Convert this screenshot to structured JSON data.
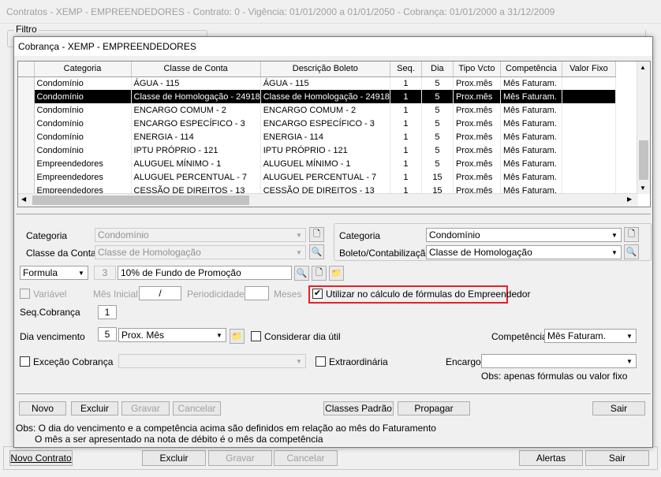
{
  "main_window": {
    "title": "Contratos - XEMP - EMPREENDEDORES - Contrato: 0 - Vigência: 01/01/2000 a 01/01/2050 - Cobrança: 01/01/2000 a 31/12/2009",
    "filter_label": "Filtro",
    "buttons": {
      "novo_contrato": "Novo Contrato",
      "excluir": "Excluir",
      "gravar": "Gravar",
      "cancelar": "Cancelar",
      "alertas": "Alertas",
      "sair": "Sair"
    }
  },
  "dialog": {
    "title": "Cobrança - XEMP - EMPREENDEDORES",
    "grid": {
      "columns": [
        "Categoria",
        "Classe de Conta",
        "Descrição Boleto",
        "Seq.",
        "Dia",
        "Tipo Vcto",
        "Competência",
        "Valor Fixo"
      ],
      "rows": [
        [
          "Condomínio",
          "ÁGUA - 115",
          "ÁGUA - 115",
          "1",
          "5",
          "Prox.mês",
          "Mês Faturam.",
          ""
        ],
        [
          "Condomínio",
          "Classe de Homologação - 24918",
          "Classe de Homologação - 24918",
          "1",
          "5",
          "Prox.mês",
          "Mês Faturam.",
          ""
        ],
        [
          "Condomínio",
          "ENCARGO COMUM - 2",
          "ENCARGO COMUM - 2",
          "1",
          "5",
          "Prox.mês",
          "Mês Faturam.",
          ""
        ],
        [
          "Condomínio",
          "ENCARGO ESPECÍFICO - 3",
          "ENCARGO ESPECÍFICO - 3",
          "1",
          "5",
          "Prox.mês",
          "Mês Faturam.",
          ""
        ],
        [
          "Condomínio",
          "ENERGIA - 114",
          "ENERGIA - 114",
          "1",
          "5",
          "Prox.mês",
          "Mês Faturam.",
          ""
        ],
        [
          "Condomínio",
          "IPTU PRÓPRIO - 121",
          "IPTU PRÓPRIO - 121",
          "1",
          "5",
          "Prox.mês",
          "Mês Faturam.",
          ""
        ],
        [
          "Empreendedores",
          "ALUGUEL MÍNIMO - 1",
          "ALUGUEL MÍNIMO - 1",
          "1",
          "5",
          "Prox.mês",
          "Mês Faturam.",
          ""
        ],
        [
          "Empreendedores",
          "ALUGUEL PERCENTUAL - 7",
          "ALUGUEL PERCENTUAL - 7",
          "1",
          "15",
          "Prox.mês",
          "Mês Faturam.",
          ""
        ],
        [
          "Empreendedores",
          "CESSÃO DE DIREITOS - 13",
          "CESSÃO DE DIREITOS - 13",
          "1",
          "15",
          "Prox.mês",
          "Mês Faturam.",
          ""
        ]
      ],
      "selected_row": 1
    },
    "form": {
      "categoria_label": "Categoria",
      "categoria_value": "Condomínio",
      "classe_conta_label": "Classe da Conta",
      "classe_conta_value": "Classe de Homologação",
      "categoria2_label": "Categoria",
      "categoria2_value": "Condomínio",
      "boleto_label": "Boleto/Contabilização",
      "boleto_value": "Classe de Homologação",
      "tipo_value": "Formula",
      "formula_num": "3",
      "formula_desc": "10% de Fundo de Promoção",
      "variavel_label": "Variável",
      "mes_inicial_label": "Mês Inicial",
      "mes_inicial_value": "/",
      "periodicidade_label": "Periodicidade",
      "meses_label": "Meses",
      "utilizar_label": "Utilizar no cálculo de fórmulas do Empreendedor",
      "utilizar_checked": "✔",
      "seq_label": "Seq.Cobrança",
      "seq_value": "1",
      "dia_label": "Dia vencimento",
      "dia_value": "5",
      "dia_tipo": "Prox. Mês",
      "considerar_label": "Considerar dia útil",
      "competencia_label": "Competência",
      "competencia_value": "Mês Faturam.",
      "excecao_label": "Exceção Cobrança",
      "extraordinaria_label": "Extraordinária",
      "encargo_label": "Encargo",
      "encargo_note": "Obs: apenas fórmulas ou valor fixo"
    },
    "buttons": {
      "novo": "Novo",
      "excluir": "Excluir",
      "gravar": "Gravar",
      "cancelar": "Cancelar",
      "classes_padrao": "Classes Padrão",
      "propagar": "Propagar",
      "sair": "Sair"
    },
    "obs_line1": "Obs: O dia do vencimento e a competência acima são definidos em relação ao mês do Faturamento",
    "obs_line2": "O mês a ser apresentado na nota de débito é o mês da competência"
  },
  "colors": {
    "highlight_border": "#e8202a",
    "selected_row": "#000000"
  }
}
